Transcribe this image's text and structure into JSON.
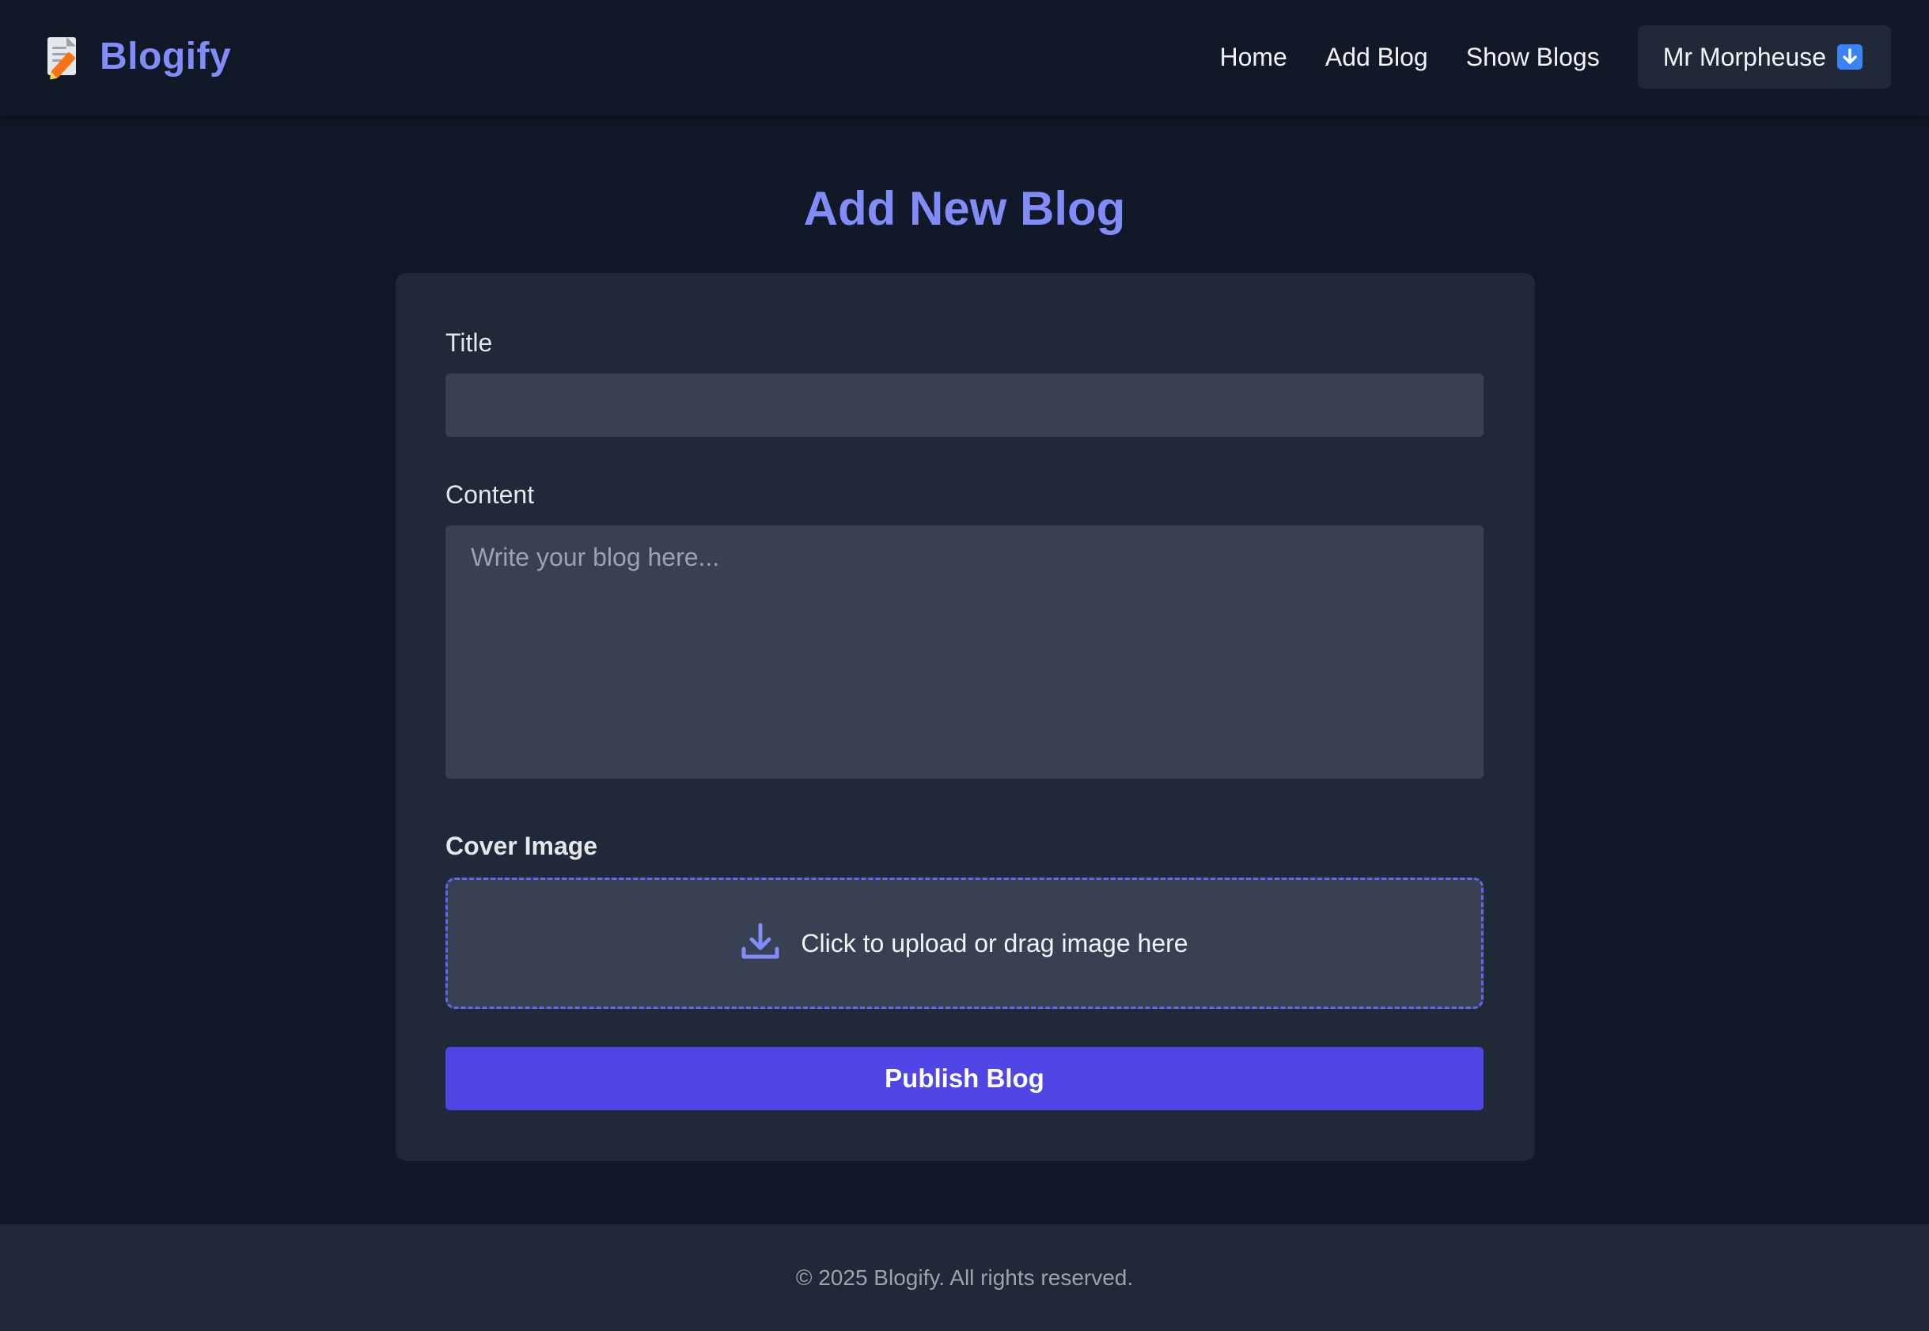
{
  "header": {
    "brand_name": "Blogify",
    "brand_icon": "memo-icon",
    "nav": {
      "home": "Home",
      "add_blog": "Add Blog",
      "show_blogs": "Show Blogs"
    },
    "user": {
      "name": "Mr Morpheuse",
      "icon": "down-arrow-icon"
    }
  },
  "main": {
    "title": "Add New Blog",
    "form": {
      "title_label": "Title",
      "title_value": "",
      "title_placeholder": "",
      "content_label": "Content",
      "content_value": "",
      "content_placeholder": "Write your blog here...",
      "cover_label": "Cover Image",
      "upload_text": "Click to upload or drag image here",
      "upload_icon": "download-tray-icon",
      "publish_label": "Publish Blog"
    }
  },
  "footer": {
    "text": "© 2025 Blogify. All rights reserved."
  },
  "colors": {
    "background": "#111827",
    "card": "#1f2937",
    "input": "#374151",
    "accent": "#818cf8",
    "primary_button": "#4f46e5",
    "dashed_border": "#6366f1"
  }
}
